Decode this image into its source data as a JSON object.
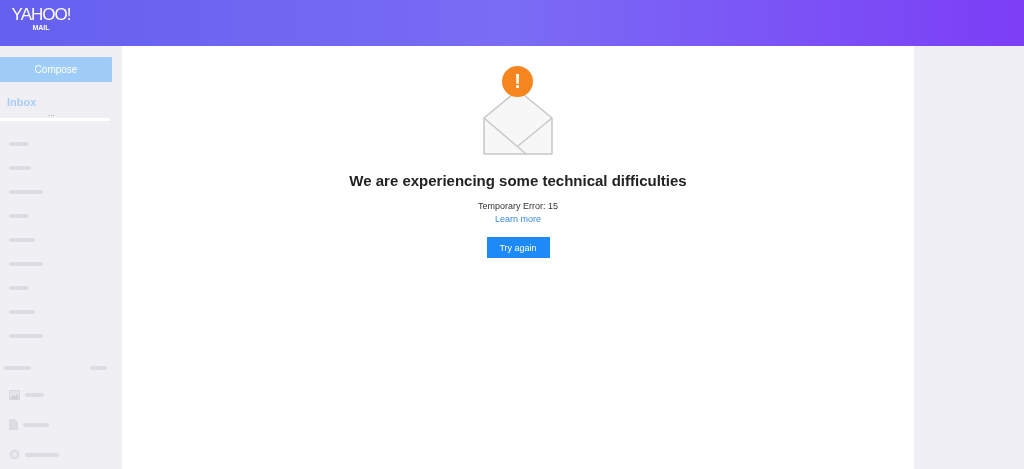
{
  "header": {
    "logo": "YAHOO!",
    "logo_sub": "MAIL"
  },
  "sidebar": {
    "compose": "Compose",
    "inbox": "Inbox",
    "more": "..."
  },
  "error": {
    "badge": "!",
    "title": "We are experiencing some technical difficulties",
    "detail": "Temporary Error: 15",
    "link": "Learn more",
    "button": "Try again"
  }
}
